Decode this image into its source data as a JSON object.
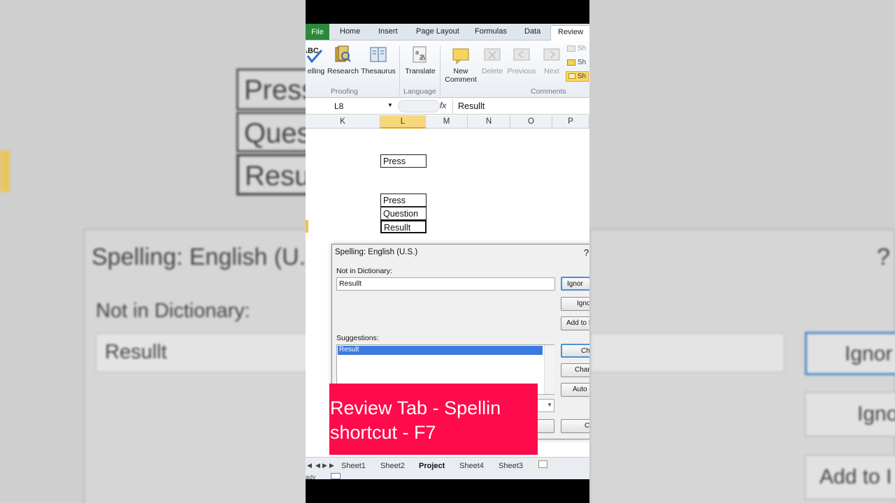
{
  "background": {
    "left_cells": [
      "Press",
      "Ques",
      "Resu"
    ],
    "left_dialog_title": "Spelling: English (U.",
    "left_not_in_dictionary": "Not in Dictionary:",
    "left_word": "Resullt",
    "right_question": "?",
    "right_buttons": [
      "Ignor",
      "Igno",
      "Add to I"
    ]
  },
  "ribbon": {
    "tabs": [
      "File",
      "Home",
      "Insert",
      "Page Layout",
      "Formulas",
      "Data",
      "Review"
    ],
    "active_tab": "Review",
    "buttons": {
      "spelling": "elling",
      "research": "Research",
      "thesaurus": "Thesaurus",
      "translate": "Translate",
      "new_comment_line1": "New",
      "new_comment_line2": "Comment",
      "delete": "Delete",
      "previous": "Previous",
      "next": "Next"
    },
    "small_items": [
      "Sh",
      "Sh",
      "Sh"
    ],
    "groups": {
      "proofing": "Proofing",
      "language": "Language",
      "comments": "Comments"
    }
  },
  "formula_bar": {
    "name_box": "L8",
    "fx": "fx",
    "value": "Resullt"
  },
  "columns": [
    "K",
    "L",
    "M",
    "N",
    "O",
    "P"
  ],
  "selected_column": "L",
  "cells": {
    "l_top": "Press",
    "l_list": [
      "Press",
      "Question",
      "Resullt"
    ]
  },
  "dialog": {
    "title": "Spelling: English (U.S.)",
    "help": "?",
    "not_in_dictionary_label": "Not in Dictionary:",
    "word": "Resullt",
    "suggestions_label": "Suggestions:",
    "suggestion_selected": "Result",
    "buttons": {
      "ignore_once": "Ignor",
      "ignore_all": "Igno",
      "add_to_dictionary": "Add to I",
      "change": "Ch",
      "change_all": "Chan",
      "autocorrect": "Auto",
      "cancel": "C"
    }
  },
  "caption": {
    "line1": "Review Tab - Spellin",
    "line2": "shortcut - F7",
    "color": "#ff0a4a"
  },
  "sheets": [
    "Sheet1",
    "Sheet2",
    "Project",
    "Sheet4",
    "Sheet3"
  ],
  "active_sheet": "Project",
  "status": "ady"
}
